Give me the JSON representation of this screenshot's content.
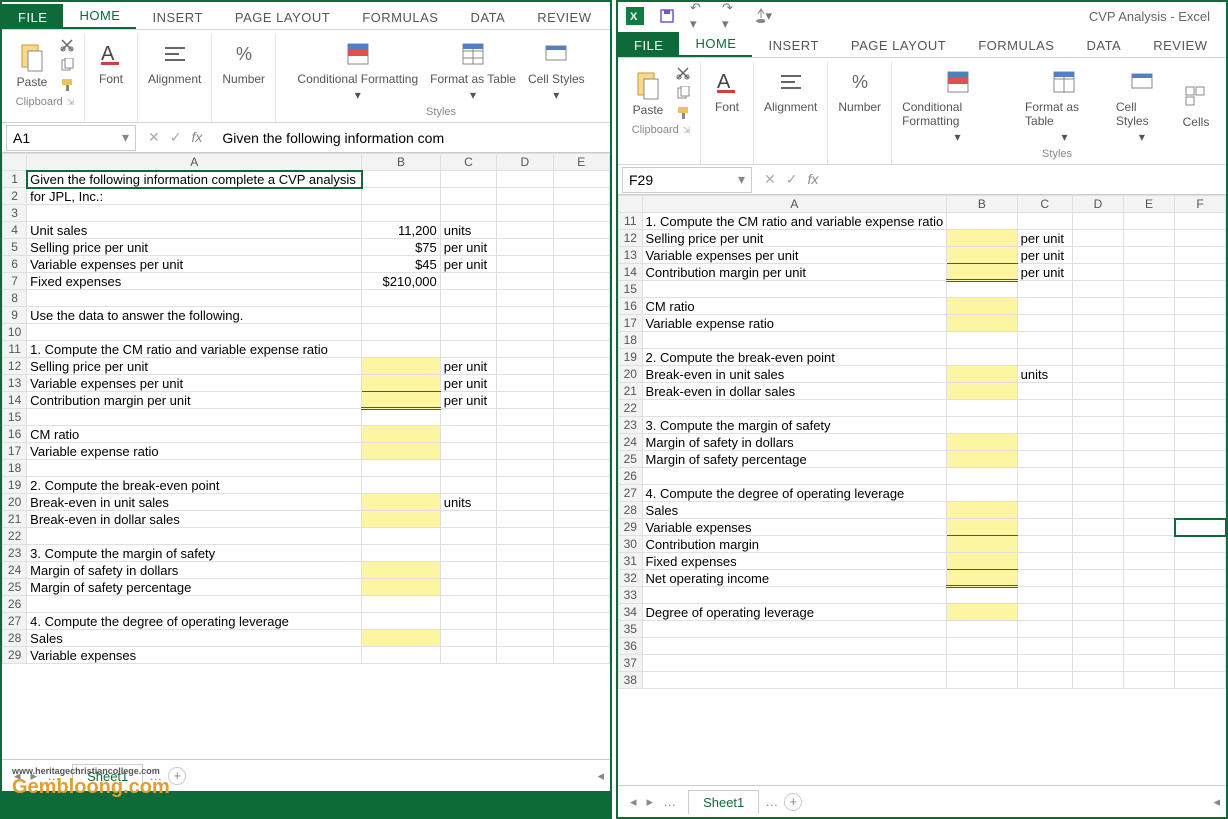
{
  "left": {
    "tabs": {
      "file": "FILE",
      "home": "HOME",
      "insert": "INSERT",
      "pageLayout": "PAGE LAYOUT",
      "formulas": "FORMULAS",
      "data": "DATA",
      "review": "REVIEW"
    },
    "ribbon": {
      "clipboard": "Clipboard",
      "paste": "Paste",
      "font": "Font",
      "alignment": "Alignment",
      "number": "Number",
      "styles": "Styles",
      "cond": "Conditional Formatting",
      "fmtTable": "Format as Table",
      "cellStyles": "Cell Styles"
    },
    "nameBox": "A1",
    "formula": "Given the following information com",
    "colHeaders": [
      "A",
      "B",
      "C",
      "D",
      "E"
    ],
    "rows": [
      {
        "n": 1,
        "a": "Given the following information complete a CVP analysis",
        "sel": true
      },
      {
        "n": 2,
        "a": "for JPL, Inc.:"
      },
      {
        "n": 3,
        "a": ""
      },
      {
        "n": 4,
        "a": "Unit sales",
        "b": "11,200",
        "c": "units"
      },
      {
        "n": 5,
        "a": "Selling price per unit",
        "b": "$75",
        "c": "per unit"
      },
      {
        "n": 6,
        "a": "Variable expenses per unit",
        "b": "$45",
        "c": "per unit"
      },
      {
        "n": 7,
        "a": "Fixed expenses",
        "b": "$210,000"
      },
      {
        "n": 8,
        "a": ""
      },
      {
        "n": 9,
        "a": "Use the data to answer the following."
      },
      {
        "n": 10,
        "a": ""
      },
      {
        "n": 11,
        "a": "1. Compute the CM ratio and variable expense ratio"
      },
      {
        "n": 12,
        "a": "Selling price per unit",
        "by": true,
        "c": "per unit"
      },
      {
        "n": 13,
        "a": "Variable expenses per unit",
        "by": true,
        "bu": true,
        "c": "per unit"
      },
      {
        "n": 14,
        "a": "Contribution margin per unit",
        "by": true,
        "bd": true,
        "c": "per unit"
      },
      {
        "n": 15,
        "a": ""
      },
      {
        "n": 16,
        "a": "CM ratio",
        "by": true
      },
      {
        "n": 17,
        "a": "Variable expense ratio",
        "by": true
      },
      {
        "n": 18,
        "a": ""
      },
      {
        "n": 19,
        "a": "2. Compute the break-even point"
      },
      {
        "n": 20,
        "a": "Break-even in unit sales",
        "by": true,
        "c": "units"
      },
      {
        "n": 21,
        "a": "Break-even in dollar sales",
        "by": true
      },
      {
        "n": 22,
        "a": ""
      },
      {
        "n": 23,
        "a": "3. Compute the margin of safety"
      },
      {
        "n": 24,
        "a": "Margin of safety in dollars",
        "by": true
      },
      {
        "n": 25,
        "a": "Margin of safety percentage",
        "by": true
      },
      {
        "n": 26,
        "a": ""
      },
      {
        "n": 27,
        "a": "4. Compute the degree of operating leverage"
      },
      {
        "n": 28,
        "a": "Sales",
        "by": true
      },
      {
        "n": 29,
        "a": "Variable expenses"
      }
    ],
    "sheet": "Sheet1"
  },
  "right": {
    "title": "CVP Analysis - Excel",
    "tabs": {
      "file": "FILE",
      "home": "HOME",
      "insert": "INSERT",
      "pageLayout": "PAGE LAYOUT",
      "formulas": "FORMULAS",
      "data": "DATA",
      "review": "REVIEW"
    },
    "ribbon": {
      "clipboard": "Clipboard",
      "paste": "Paste",
      "font": "Font",
      "alignment": "Alignment",
      "number": "Number",
      "styles": "Styles",
      "cond": "Conditional Formatting",
      "fmtTable": "Format as Table",
      "cellStyles": "Cell Styles",
      "cells": "Cells"
    },
    "nameBox": "F29",
    "formula": "",
    "colHeaders": [
      "A",
      "B",
      "C",
      "D",
      "E"
    ],
    "rows": [
      {
        "n": 11,
        "a": "1. Compute the CM ratio and variable expense ratio"
      },
      {
        "n": 12,
        "a": "Selling price per unit",
        "by": true,
        "c": "per unit"
      },
      {
        "n": 13,
        "a": "Variable expenses per unit",
        "by": true,
        "bu": true,
        "c": "per unit"
      },
      {
        "n": 14,
        "a": "Contribution margin per unit",
        "by": true,
        "bd": true,
        "c": "per unit"
      },
      {
        "n": 15,
        "a": ""
      },
      {
        "n": 16,
        "a": "CM ratio",
        "by": true
      },
      {
        "n": 17,
        "a": "Variable expense ratio",
        "by": true
      },
      {
        "n": 18,
        "a": ""
      },
      {
        "n": 19,
        "a": "2. Compute the break-even point"
      },
      {
        "n": 20,
        "a": "Break-even in unit sales",
        "by": true,
        "c": "units"
      },
      {
        "n": 21,
        "a": "Break-even in dollar sales",
        "by": true
      },
      {
        "n": 22,
        "a": ""
      },
      {
        "n": 23,
        "a": "3. Compute the margin of safety"
      },
      {
        "n": 24,
        "a": "Margin of safety in dollars",
        "by": true
      },
      {
        "n": 25,
        "a": "Margin of safety percentage",
        "by": true
      },
      {
        "n": 26,
        "a": ""
      },
      {
        "n": 27,
        "a": "4. Compute the degree of operating leverage"
      },
      {
        "n": 28,
        "a": "Sales",
        "by": true
      },
      {
        "n": 29,
        "a": "Variable expenses",
        "by": true,
        "bu": true,
        "selF": true
      },
      {
        "n": 30,
        "a": "Contribution margin",
        "by": true
      },
      {
        "n": 31,
        "a": "Fixed expenses",
        "by": true,
        "bu": true
      },
      {
        "n": 32,
        "a": "Net operating income",
        "by": true,
        "bd": true
      },
      {
        "n": 33,
        "a": ""
      },
      {
        "n": 34,
        "a": "Degree of operating leverage",
        "by": true
      },
      {
        "n": 35,
        "a": ""
      },
      {
        "n": 36,
        "a": ""
      },
      {
        "n": 37,
        "a": ""
      },
      {
        "n": 38,
        "a": ""
      }
    ],
    "sheet": "Sheet1"
  },
  "watermark": "Gembloong.com",
  "sourceUrl": "www.heritagechristiancollege.com"
}
